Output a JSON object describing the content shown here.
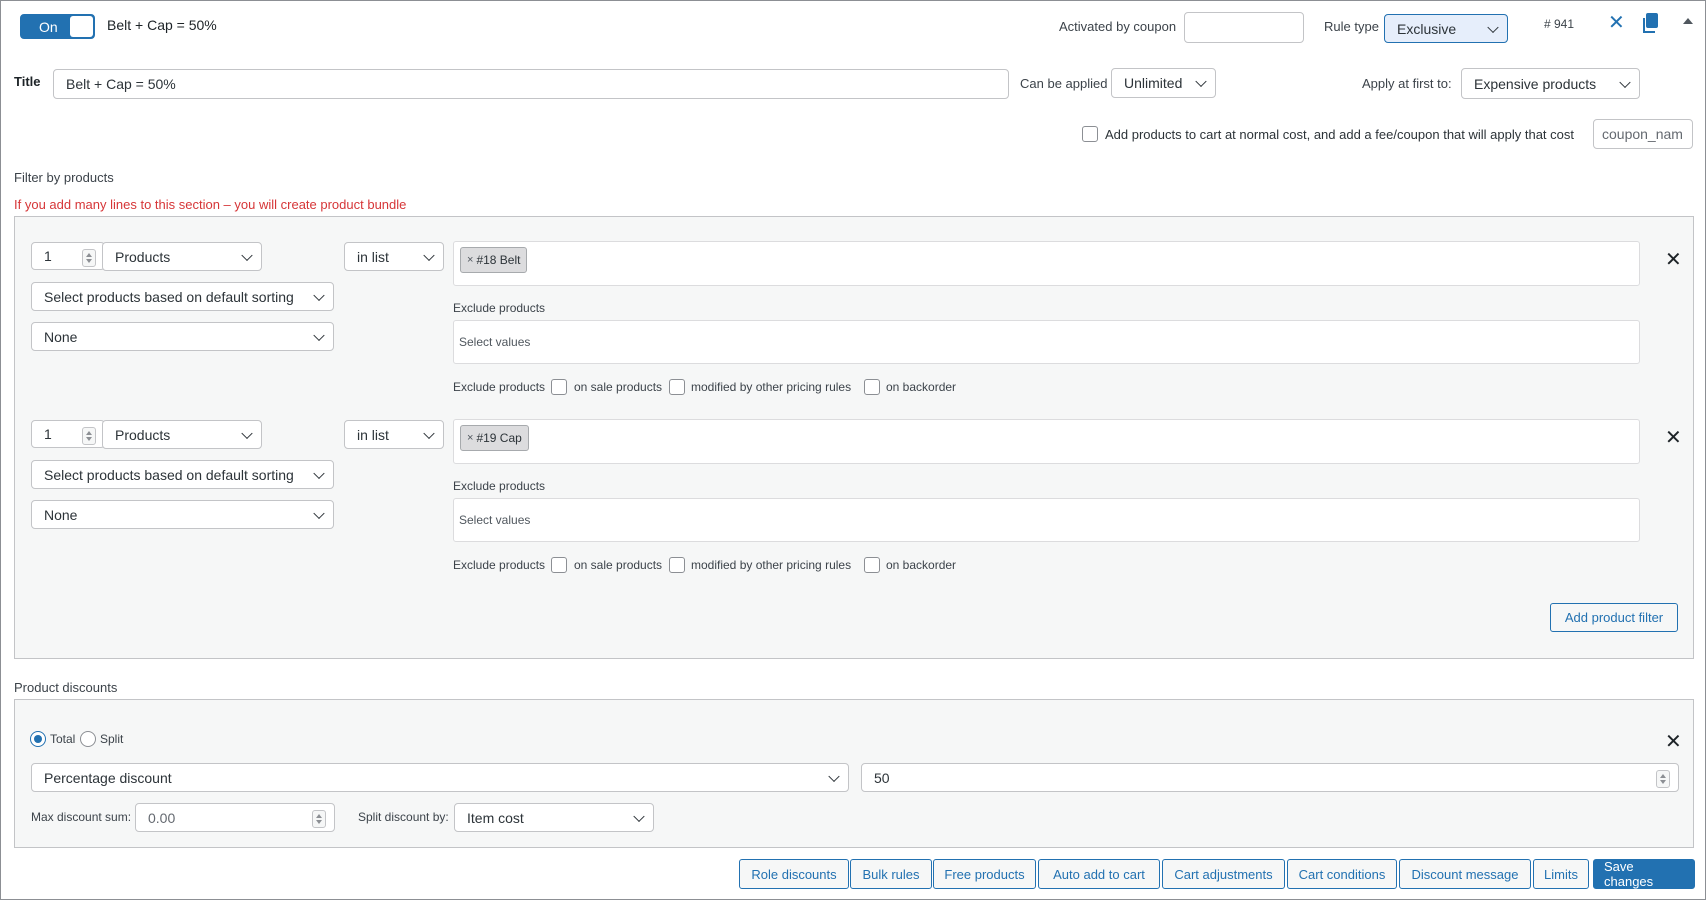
{
  "header": {
    "toggle_label": "On",
    "rule_name": "Belt + Cap = 50%",
    "activated_by_coupon_label": "Activated by coupon",
    "coupon_value": "",
    "rule_type_label": "Rule type",
    "rule_type_value": "Exclusive",
    "rule_id": "# 941"
  },
  "title_row": {
    "title_label": "Title",
    "title_value": "Belt + Cap = 50%",
    "can_be_applied_label": "Can be applied",
    "can_be_applied_value": "Unlimited",
    "apply_first_label": "Apply at first to:",
    "apply_first_value": "Expensive products"
  },
  "fee_row": {
    "label": "Add products to cart at normal cost, and add a fee/coupon that will apply that cost",
    "coupon_placeholder": "coupon_nam"
  },
  "filters": {
    "section_label": "Filter by products",
    "warning": "If you add many lines to this section – you will create product bundle",
    "rows": [
      {
        "qty": "1",
        "type": "Products",
        "operator": "in list",
        "sorting": "Select products based on default sorting",
        "sorting2": "None",
        "tag": "#18 Belt",
        "tag_remove": "×",
        "exclude_label": "Exclude products",
        "exclude_placeholder": "Select values",
        "exclude_opts_label": "Exclude products",
        "opt_on_sale": "on sale products",
        "opt_modified": "modified by other pricing rules",
        "opt_backorder": "on backorder"
      },
      {
        "qty": "1",
        "type": "Products",
        "operator": "in list",
        "sorting": "Select products based on default sorting",
        "sorting2": "None",
        "tag": "#19 Cap",
        "tag_remove": "×",
        "exclude_label": "Exclude products",
        "exclude_placeholder": "Select values",
        "exclude_opts_label": "Exclude products",
        "opt_on_sale": "on sale products",
        "opt_modified": "modified by other pricing rules",
        "opt_backorder": "on backorder"
      }
    ],
    "add_filter_button": "Add product filter"
  },
  "discounts": {
    "section_label": "Product discounts",
    "radio_total": "Total",
    "radio_split": "Split",
    "discount_type": "Percentage discount",
    "discount_value": "50",
    "max_sum_label": "Max discount sum:",
    "max_sum_placeholder": "0.00",
    "split_by_label": "Split discount by:",
    "split_by_value": "Item cost"
  },
  "footer_buttons": {
    "role_discounts": "Role discounts",
    "bulk_rules": "Bulk rules",
    "free_products": "Free products",
    "auto_add": "Auto add to cart",
    "cart_adjustments": "Cart adjustments",
    "cart_conditions": "Cart conditions",
    "discount_message": "Discount message",
    "limits": "Limits",
    "save_changes": "Save changes"
  },
  "icons": {
    "close": "close-icon",
    "copy": "copy-icon",
    "collapse": "collapse-up-icon",
    "remove_row": "remove-row-icon"
  },
  "colors": {
    "accent": "#2271b1",
    "warning": "#d63638",
    "panel_bg": "#f6f7f7"
  }
}
